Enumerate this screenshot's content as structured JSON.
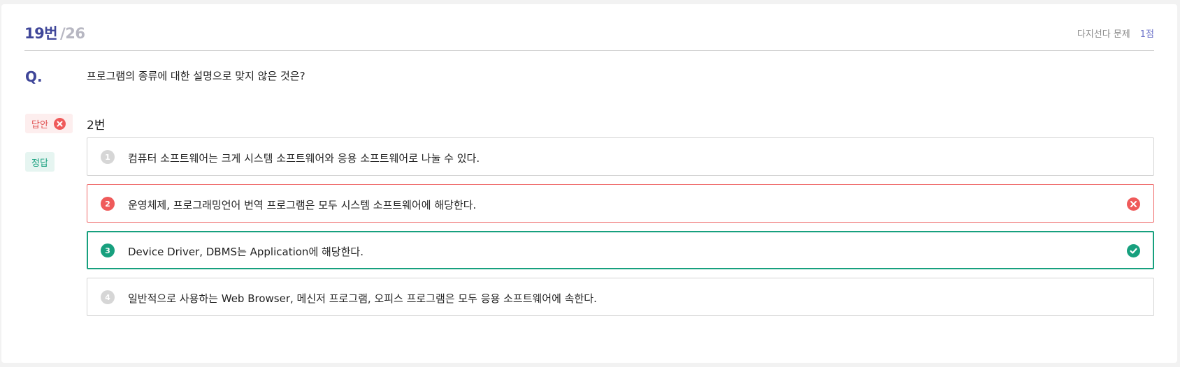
{
  "header": {
    "question_number": "19번",
    "question_total": "/26",
    "question_type": "다지선다 문제",
    "points": "1점"
  },
  "question": {
    "label": "Q.",
    "text": "프로그램의 종류에 대한 설명으로 맞지 않은 것은?"
  },
  "answer": {
    "badge_label": "답안",
    "value": "2번",
    "status_icon": "x-circle-icon"
  },
  "correct": {
    "badge_label": "정답"
  },
  "options": [
    {
      "number": "1",
      "text": "컴퓨터 소프트웨어는 크게 시스템 소프트웨어와 응용 소프트웨어로 나눌 수 있다.",
      "state": "default"
    },
    {
      "number": "2",
      "text": "운영체제, 프로그래밍언어 번역 프로그램은 모두 시스템 소프트웨어에 해당한다.",
      "state": "selected-wrong"
    },
    {
      "number": "3",
      "text": "Device Driver, DBMS는 Application에 해당한다.",
      "state": "correct"
    },
    {
      "number": "4",
      "text": "일반적으로 사용하는 Web Browser, 메신저 프로그램, 오피스 프로그램은 모두 응용 소프트웨어에 속한다.",
      "state": "default"
    }
  ],
  "colors": {
    "accent": "#3f4699",
    "wrong": "#ef5a5a",
    "right": "#17a07e",
    "muted": "#d6d6d6"
  }
}
